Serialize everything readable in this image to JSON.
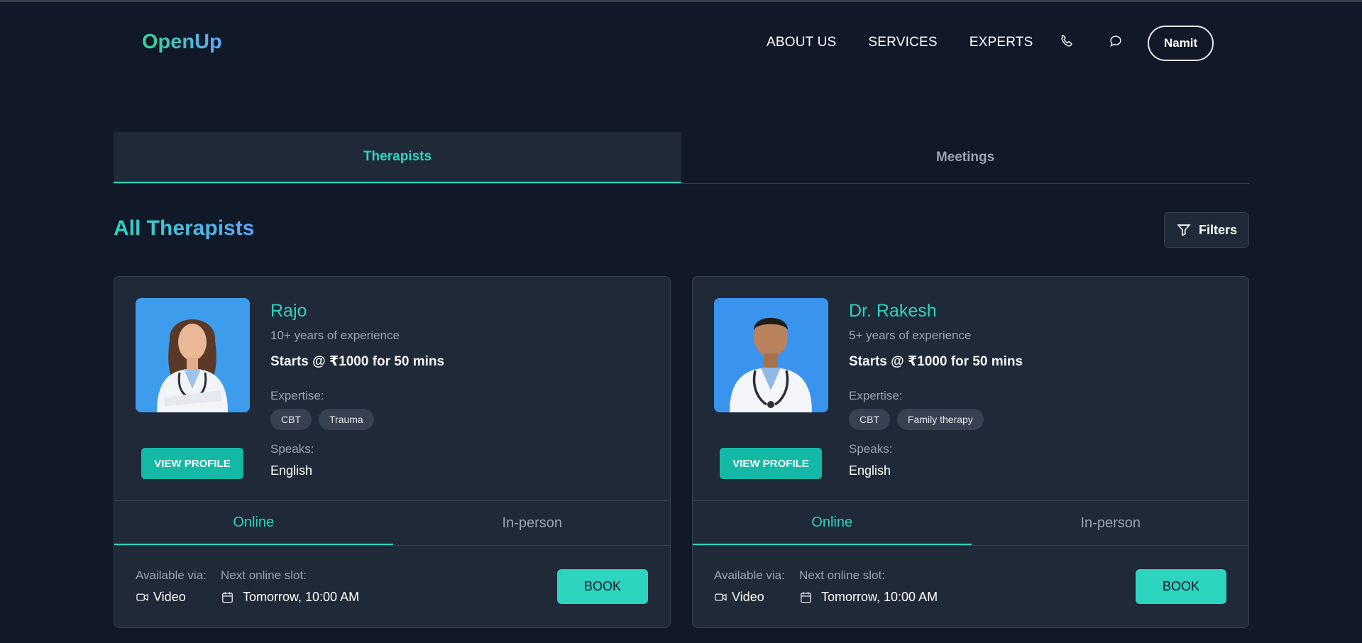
{
  "header": {
    "logo": "OpenUp",
    "nav": [
      "ABOUT US",
      "SERVICES",
      "EXPERTS"
    ],
    "user": "Namit"
  },
  "tabs": [
    {
      "label": "Therapists",
      "active": true
    },
    {
      "label": "Meetings",
      "active": false
    }
  ],
  "section": {
    "title": "All Therapists",
    "filters_label": "Filters"
  },
  "therapists": [
    {
      "name": "Rajo",
      "experience": "10+ years of experience",
      "price": "Starts @ ₹1000 for 50 mins",
      "expertise_label": "Expertise:",
      "expertise": [
        "CBT",
        "Trauma"
      ],
      "speaks_label": "Speaks:",
      "speaks": "English",
      "view_profile": "VIEW PROFILE",
      "modes": [
        "Online",
        "In-person"
      ],
      "active_mode": "Online",
      "available_label": "Available via:",
      "available_value": "Video",
      "slot_label": "Next online slot:",
      "slot_value": "Tomorrow, 10:00 AM",
      "book": "BOOK"
    },
    {
      "name": "Dr. Rakesh",
      "experience": "5+ years of experience",
      "price": "Starts @ ₹1000 for 50 mins",
      "expertise_label": "Expertise:",
      "expertise": [
        "CBT",
        "Family therapy"
      ],
      "speaks_label": "Speaks:",
      "speaks": "English",
      "view_profile": "VIEW PROFILE",
      "modes": [
        "Online",
        "In-person"
      ],
      "active_mode": "Online",
      "available_label": "Available via:",
      "available_value": "Video",
      "slot_label": "Next online slot:",
      "slot_value": "Tomorrow, 10:00 AM",
      "book": "BOOK"
    }
  ],
  "icons": {
    "phone": "phone-icon",
    "chat": "chat-icon",
    "filter": "filter-icon",
    "video": "video-icon",
    "calendar": "calendar-icon"
  },
  "colors": {
    "background": "#111827",
    "card": "#1f2937",
    "accent": "#2dd4bf",
    "button": "#14b8a6"
  }
}
